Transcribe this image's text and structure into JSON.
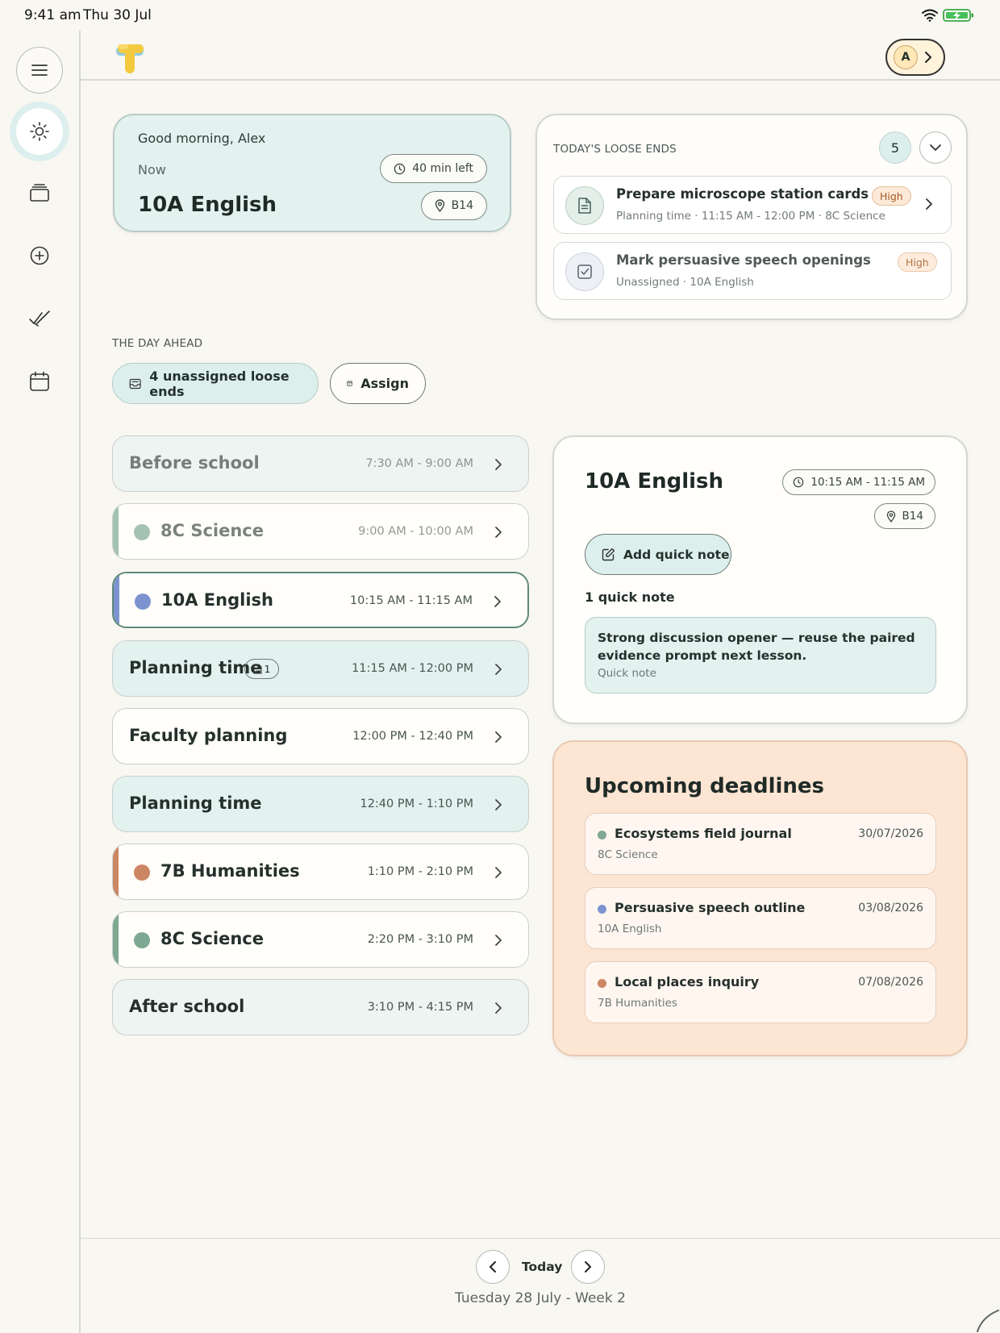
{
  "status_bar": {
    "time": "9:41 am",
    "date": "Thu 30 Jul"
  },
  "colors": {
    "teal_card": "#e3f1ef",
    "deadline_card": "#fde5d3",
    "science": "#7ea891",
    "english": "#7c93cf",
    "humanities": "#cd8664",
    "high_badge": "#fde9d7"
  },
  "sidebar": {
    "items": [
      {
        "icon": "menu-icon"
      },
      {
        "icon": "sun-icon",
        "active": true
      },
      {
        "icon": "stack-icon"
      },
      {
        "icon": "plus-circle-icon"
      },
      {
        "icon": "double-check-icon"
      },
      {
        "icon": "calendar-icon"
      }
    ]
  },
  "header": {
    "account_initial": "A"
  },
  "now_card": {
    "greeting": "Good morning, Alex",
    "label": "Now",
    "class_name": "10A English",
    "time_left": "40 min left",
    "room": "B14"
  },
  "loose_ends": {
    "title": "TODAY'S LOOSE ENDS",
    "count": "5",
    "items": [
      {
        "title": "Prepare microscope station cards",
        "subtitle": "Planning time · 11:15 AM - 12:00 PM · 8C Science",
        "priority": "High",
        "icon": "document-icon"
      },
      {
        "title": "Mark persuasive speech openings",
        "subtitle": "Unassigned · 10A English",
        "priority": "High",
        "icon": "checkbox-icon"
      }
    ]
  },
  "day_ahead": {
    "title": "THE DAY AHEAD",
    "unassigned_label": "4 unassigned loose ends",
    "assign_label": "Assign",
    "periods": [
      {
        "name": "Before school",
        "time": "7:30 AM - 9:00 AM"
      },
      {
        "name": "8C Science",
        "time": "9:00 AM - 10:00 AM"
      },
      {
        "name": "10A English",
        "time": "10:15 AM - 11:15 AM"
      },
      {
        "name": "Planning time",
        "time": "11:15 AM - 12:00 PM",
        "note_count": "1"
      },
      {
        "name": "Faculty planning",
        "time": "12:00 PM - 12:40 PM"
      },
      {
        "name": "Planning time",
        "time": "12:40 PM - 1:10 PM"
      },
      {
        "name": "7B Humanities",
        "time": "1:10 PM - 2:10 PM"
      },
      {
        "name": "8C Science",
        "time": "2:20 PM - 3:10 PM"
      },
      {
        "name": "After school",
        "time": "3:10 PM - 4:15 PM"
      }
    ]
  },
  "detail": {
    "title": "10A English",
    "time": "10:15 AM - 11:15 AM",
    "room": "B14",
    "add_note_label": "Add quick note",
    "notes_count_label": "1 quick note",
    "note_text": "Strong discussion opener — reuse the paired evidence prompt next lesson.",
    "note_kind": "Quick note"
  },
  "deadlines": {
    "title": "Upcoming deadlines",
    "items": [
      {
        "name": "Ecosystems field journal",
        "date": "30/07/2026",
        "class": "8C Science"
      },
      {
        "name": "Persuasive speech outline",
        "date": "03/08/2026",
        "class": "10A English"
      },
      {
        "name": "Local places inquiry",
        "date": "07/08/2026",
        "class": "7B Humanities"
      }
    ]
  },
  "footer": {
    "today_label": "Today",
    "week_label": "Tuesday 28 July - Week 2"
  }
}
